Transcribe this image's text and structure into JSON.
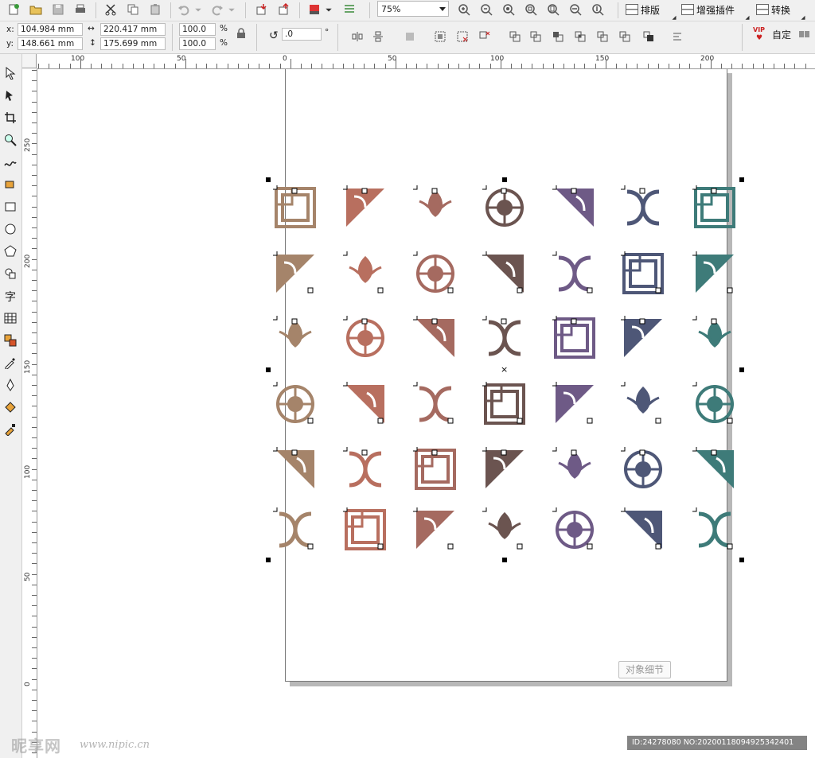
{
  "toolbar": {
    "zoom_value": "75%",
    "menus": [
      {
        "label": "排版"
      },
      {
        "label": "增强插件"
      },
      {
        "label": "转换"
      }
    ],
    "vip_label": "VIP",
    "vip_text": "自定"
  },
  "property_bar": {
    "x_label": "x:",
    "y_label": "y:",
    "x_value": "104.984 mm",
    "y_value": "148.661 mm",
    "width_value": "220.417 mm",
    "height_value": "175.699 mm",
    "scale_w": "100.0",
    "scale_h": "100.0",
    "percent": "%",
    "rotation_value": ".0",
    "degree": "°"
  },
  "ruler_top": {
    "labels": [
      "100",
      "50",
      "0",
      "50",
      "100",
      "150",
      "200"
    ]
  },
  "ruler_left": {
    "labels": [
      "250",
      "200",
      "150",
      "100",
      "50",
      "0"
    ]
  },
  "canvas": {
    "detail_button": "对象细节",
    "colors": {
      "col1": "#a5846a",
      "col2": "#b86f5f",
      "col3": "#a56a60",
      "col4": "#6b5450",
      "col5": "#6e5a86",
      "col6": "#4e5777",
      "col7": "#3e7b79"
    }
  },
  "watermark": {
    "brand": "昵享网",
    "url": "www.nipic.cn",
    "id_text": "ID:24278080 NO:20200118094925342401"
  }
}
